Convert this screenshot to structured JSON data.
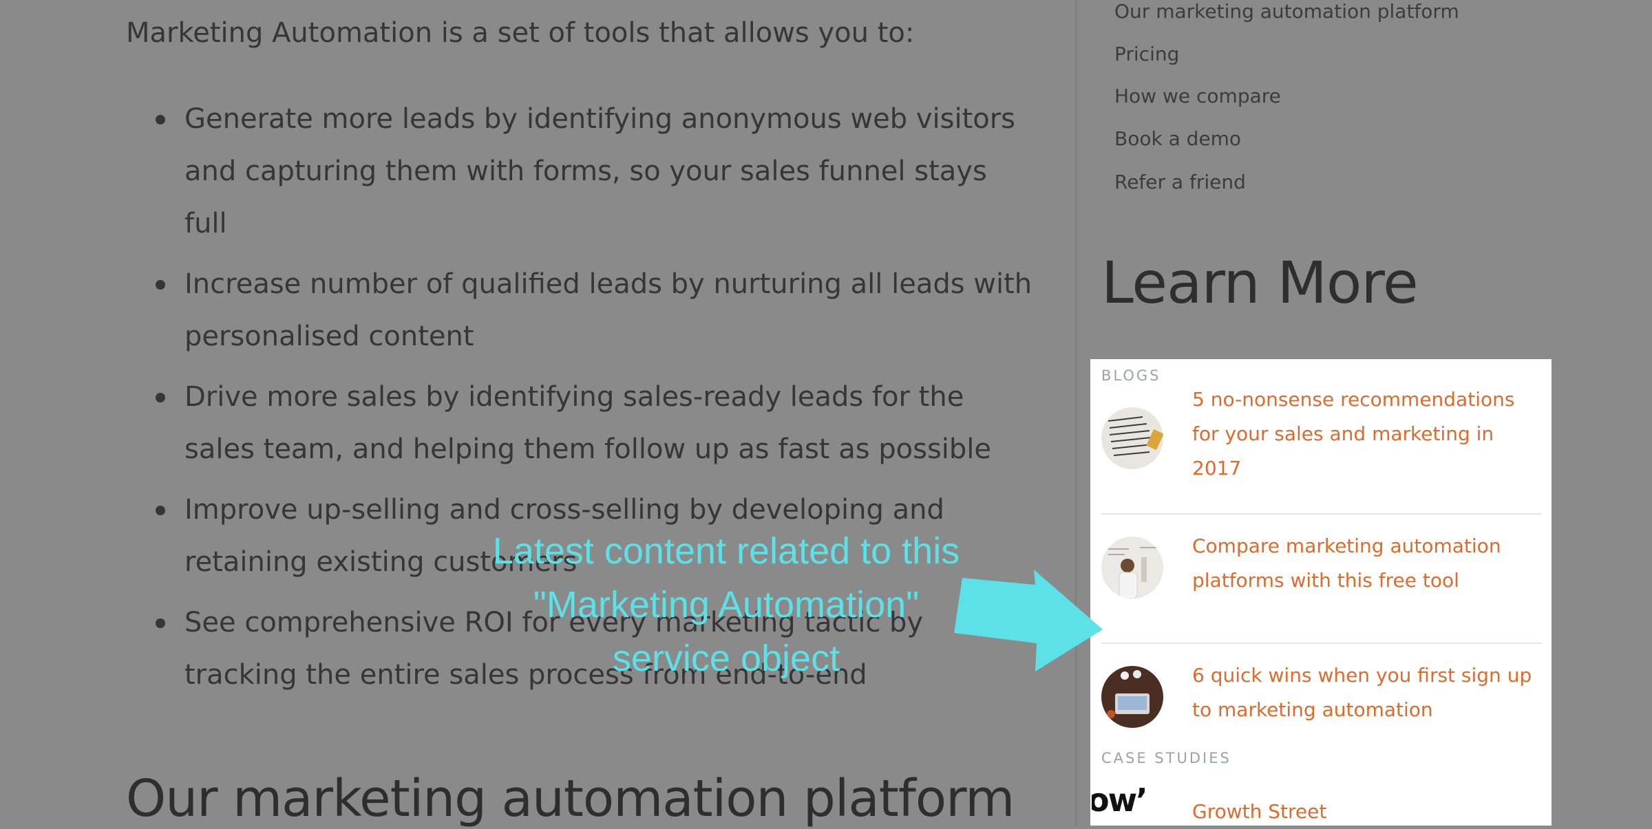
{
  "main": {
    "intro": "Marketing Automation is a set of tools that allows you to:",
    "bullets": [
      "Generate more leads by identifying anonymous web visitors and capturing them with forms, so your sales funnel stays full",
      "Increase number of qualified leads by nurturing all leads with personalised content",
      "Drive more sales by identifying sales-ready leads for the sales team, and helping them follow up as fast as possible",
      "Improve up-selling and cross-selling by developing and retaining existing customers",
      "See comprehensive ROI for every marketing tactic by tracking the entire sales process from end-to-end"
    ],
    "next_heading": "Our marketing automation platform"
  },
  "sidebar": {
    "nav": [
      "Our marketing automation platform",
      "Pricing",
      "How we compare",
      "Book a demo",
      "Refer a friend"
    ],
    "learn_more_heading": "Learn More",
    "blogs_label": "BLOGS",
    "blogs": [
      {
        "title": "5 no-nonsense recommendations for your sales and marketing in 2017"
      },
      {
        "title": "Compare marketing automation platforms with this free tool"
      },
      {
        "title": "6 quick wins when you first sign up to marketing automation"
      }
    ],
    "case_studies_label": "CASE STUDIES",
    "case_studies": [
      {
        "title": "Growth Street",
        "logo_text": "ow’"
      }
    ]
  },
  "annotation": {
    "lines": [
      "Latest content related to this",
      "\"Marketing Automation\"",
      "service object"
    ],
    "color": "#5ce1e6"
  },
  "colors": {
    "link_orange": "#e06a2c",
    "label_gray": "#9aa3a8",
    "overlay": "rgba(0,0,0,0.46)"
  }
}
